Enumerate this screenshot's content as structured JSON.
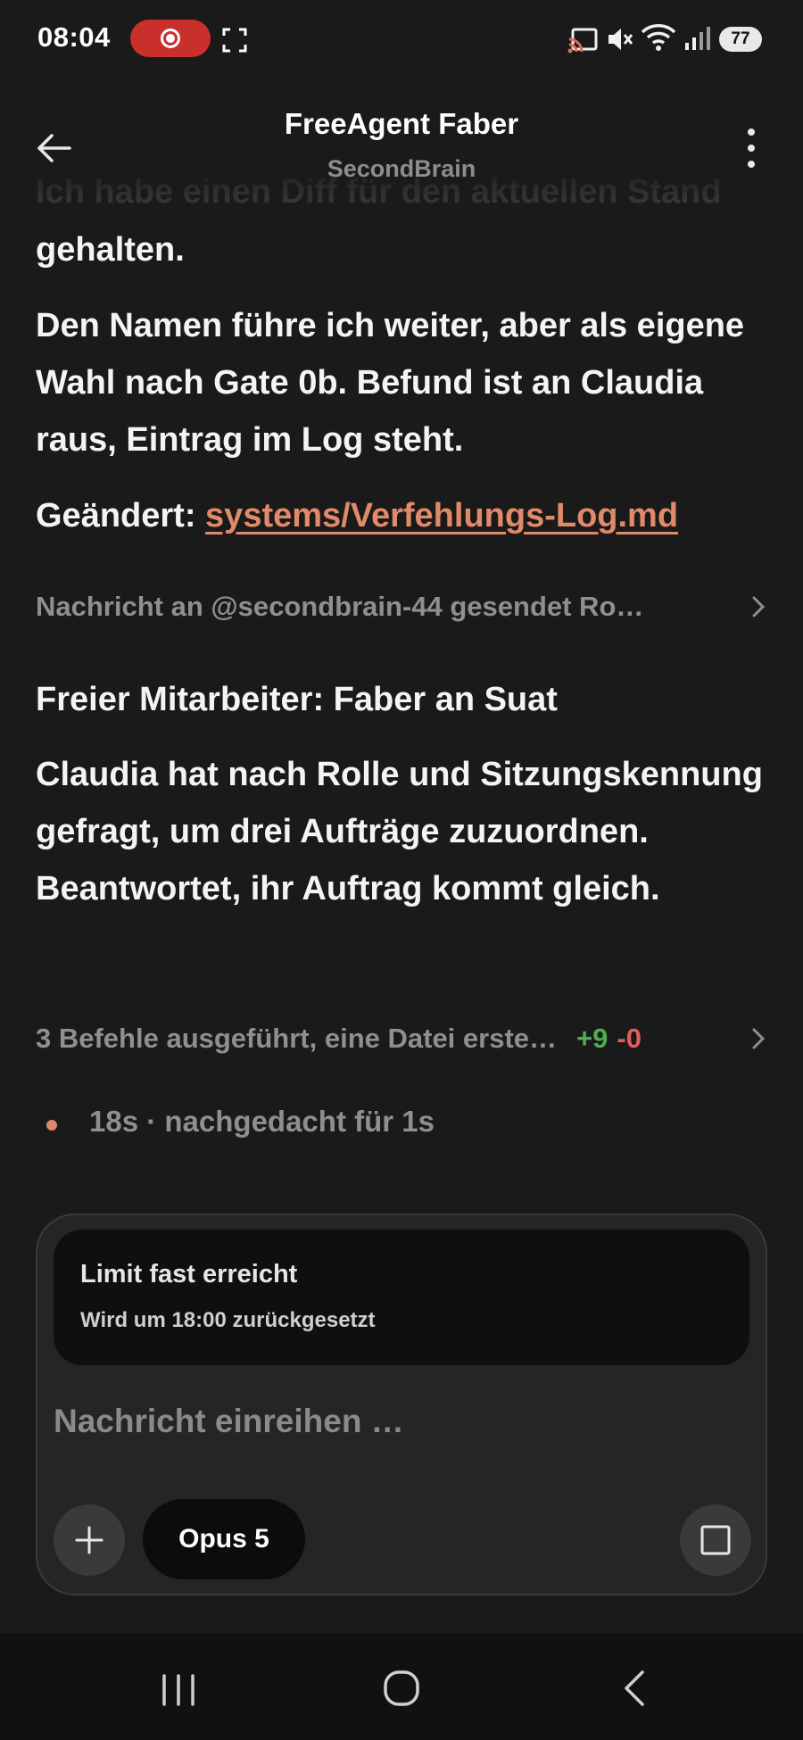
{
  "status_bar": {
    "time": "08:04",
    "battery": "77",
    "icons": [
      "record-icon",
      "fullscreen-icon",
      "cast-icon",
      "mute-icon",
      "wifi-icon",
      "signal-icon"
    ],
    "record_color": "#c9302c"
  },
  "header": {
    "title": "FreeAgent Faber",
    "subtitle": "SecondBrain"
  },
  "conversation": {
    "faded_line": "Ich habe einen Diff für den aktuellen Stand",
    "line_continuation": "gehalten.",
    "paragraph_1": "Den Namen führe ich weiter, aber als eigene Wahl nach Gate 0b. Befund ist an Claudia raus, Eintrag im Log steht.",
    "changed_label": "Geändert:",
    "changed_link": "systems/Verfehlungs-Log.md",
    "collapsed_message": "Nachricht an @secondbrain-44 gesendet Ro…",
    "heading": "Freier Mitarbeiter: Faber an Suat",
    "paragraph_2": "Claudia hat nach Rolle und Sitzungskennung gefragt, um drei Aufträge zuzuordnen. Beantwortet, ihr Auftrag kommt gleich.",
    "commands_summary": "3 Befehle ausgeführt, eine Datei erste…",
    "diff_added": "+9",
    "diff_removed": "-0",
    "thinking_status": "18s · nachgedacht für 1s"
  },
  "composer": {
    "limit_title": "Limit fast erreicht",
    "limit_subtitle": "Wird um 18:00 zurückgesetzt",
    "placeholder": "Nachricht einreihen …",
    "model_label": "Opus 5"
  },
  "colors": {
    "accent": "#e0866a",
    "link": "#e08a6a",
    "diff_add": "#4caf50",
    "diff_remove": "#e45c5c",
    "background": "#1a1a1a"
  }
}
